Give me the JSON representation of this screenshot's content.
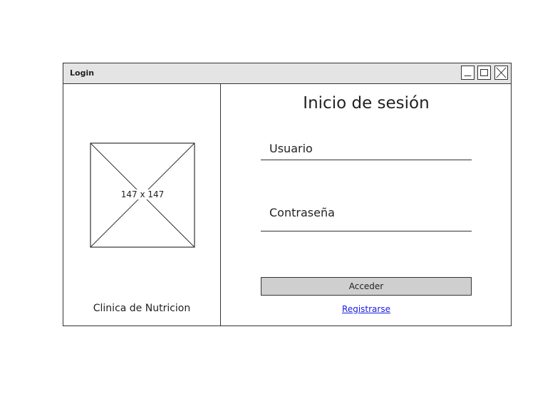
{
  "window": {
    "title": "Login",
    "controls": [
      "minimize-icon",
      "maximize-icon",
      "close-icon"
    ]
  },
  "left_panel": {
    "image_placeholder_text": "147 x 147",
    "clinic_name": "Clinica de Nutricion"
  },
  "form": {
    "heading": "Inicio de sesión",
    "username_label": "Usuario",
    "password_label": "Contraseña",
    "submit_label": "Acceder",
    "register_link": "Registrarse"
  },
  "colors": {
    "titlebar": "#e4e4e4",
    "button": "#cfcfcf",
    "link": "#1a1ae6",
    "border": "#333333"
  }
}
